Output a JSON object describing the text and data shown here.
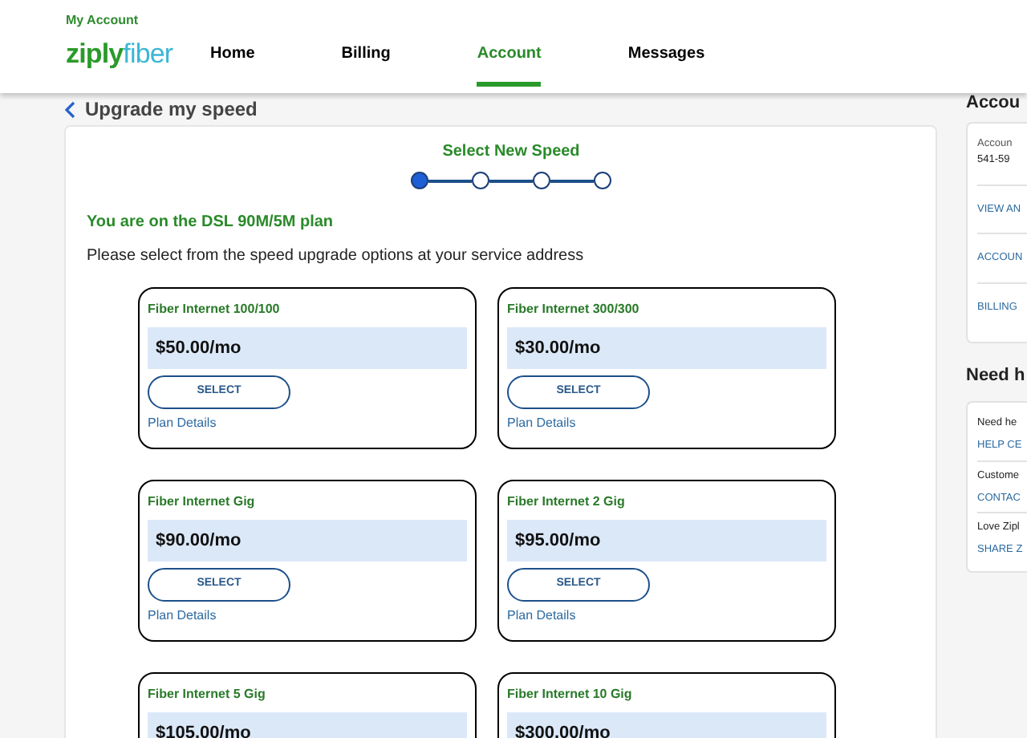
{
  "header": {
    "section": "My Account",
    "logo": {
      "part_1": "ziply",
      "part_2": "fiber"
    },
    "nav": [
      {
        "label": "Home",
        "selected": false
      },
      {
        "label": "Billing",
        "selected": false
      },
      {
        "label": "Account",
        "selected": true
      },
      {
        "label": "Messages",
        "selected": false
      }
    ]
  },
  "page_title": "Upgrade my speed",
  "stepper": {
    "title": "Select New Speed",
    "steps": [
      {
        "selected": true
      },
      {
        "selected": false
      },
      {
        "selected": false
      },
      {
        "selected": false
      }
    ]
  },
  "current_plan": "You are on the DSL 90M/5M plan",
  "instructions": "Please select from the speed upgrade options at your service address",
  "plans": [
    {
      "name": "Fiber Internet 100/100",
      "price": "$50.00/mo",
      "button": "SELECT",
      "link": "Plan Details"
    },
    {
      "name": "Fiber Internet 300/300",
      "price": "$30.00/mo",
      "button": "SELECT",
      "link": "Plan Details"
    },
    {
      "name": "Fiber Internet Gig",
      "price": "$90.00/mo",
      "button": "SELECT",
      "link": "Plan Details"
    },
    {
      "name": "Fiber Internet 2 Gig",
      "price": "$95.00/mo",
      "button": "SELECT",
      "link": "Plan Details"
    },
    {
      "name": "Fiber Internet 5 Gig",
      "price": "$105.00/mo"
    },
    {
      "name": "Fiber Internet 10 Gig",
      "price": "$300.00/mo"
    }
  ],
  "sidebar": {
    "account_heading": "Accou",
    "account_card": {
      "label": "Accoun",
      "number": "541-59",
      "links": [
        "VIEW AN",
        "ACCOUN",
        "BILLING"
      ]
    },
    "help_heading": "Need h",
    "help_items": [
      {
        "text": "Need he",
        "link": "HELP CE"
      },
      {
        "text": "Custome",
        "link": "CONTAC"
      },
      {
        "text": "Love Zipl",
        "link": "SHARE Z"
      }
    ]
  }
}
